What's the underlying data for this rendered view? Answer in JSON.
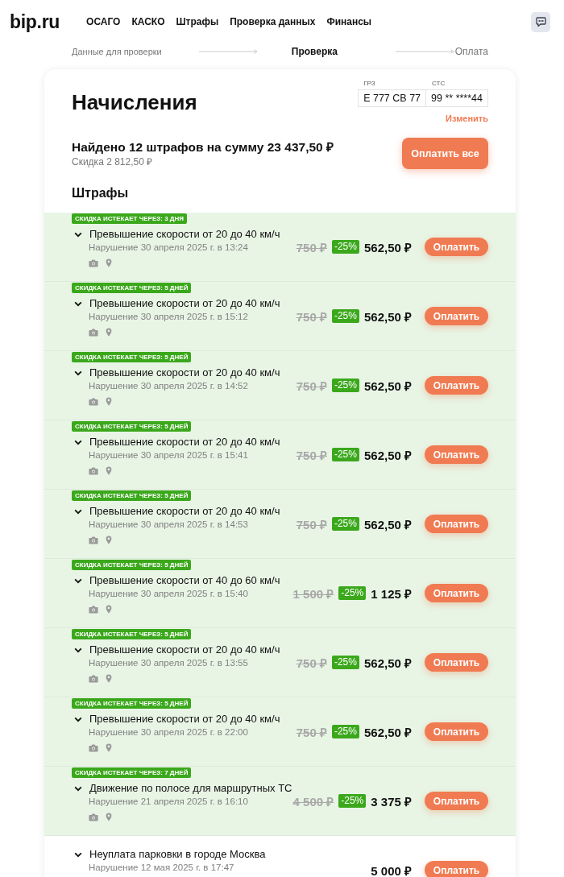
{
  "header": {
    "logo": "bip.ru",
    "nav": [
      {
        "label": "ОСАГО"
      },
      {
        "label": "КАСКО"
      },
      {
        "label": "Штрафы"
      },
      {
        "label": "Проверка данных"
      },
      {
        "label": "Финансы"
      }
    ]
  },
  "stepper": [
    {
      "label": "Данные для проверки",
      "selected": false
    },
    {
      "label": "Проверка",
      "selected": true
    },
    {
      "label": "Оплата",
      "selected": false
    }
  ],
  "charges": {
    "title": "Начисления",
    "documents": [
      {
        "label": "ГРЗ",
        "value": "Е 777 СВ 77"
      },
      {
        "label": "СТС",
        "value": "99 ** ****44"
      }
    ],
    "change_link": "Изменить",
    "summary": "Найдено 12 штрафов на сумму 23 437,50 ₽",
    "discount": "Скидка 2 812,50 ₽",
    "pay_all_button": "Оплатить все",
    "section_title": "Штрафы",
    "fines": [
      {
        "kind": "discounted",
        "badge": "СКИДКА ИСТЕКАЕТ ЧЕРЕЗ: 3 ДНЯ",
        "title": "Превышение скорости от 20 до 40 км/ч",
        "date": "Нарушение 30 апреля 2025 г. в 13:24",
        "old_price": "750 ₽",
        "discount": "-25%",
        "price": "562,50 ₽",
        "button": "Оплатить"
      },
      {
        "kind": "discounted",
        "badge": "СКИДКА ИСТЕКАЕТ ЧЕРЕЗ: 5 ДНЕЙ",
        "title": "Превышение скорости от 20 до 40 км/ч",
        "date": "Нарушение 30 апреля 2025 г. в 15:12",
        "old_price": "750 ₽",
        "discount": "-25%",
        "price": "562,50 ₽",
        "button": "Оплатить"
      },
      {
        "kind": "discounted",
        "badge": "СКИДКА ИСТЕКАЕТ ЧЕРЕЗ: 5 ДНЕЙ",
        "title": "Превышение скорости от 20 до 40 км/ч",
        "date": "Нарушение 30 апреля 2025 г. в 14:52",
        "old_price": "750 ₽",
        "discount": "-25%",
        "price": "562,50 ₽",
        "button": "Оплатить"
      },
      {
        "kind": "discounted",
        "badge": "СКИДКА ИСТЕКАЕТ ЧЕРЕЗ: 5 ДНЕЙ",
        "title": "Превышение скорости от 20 до 40 км/ч",
        "date": "Нарушение 30 апреля 2025 г. в 15:41",
        "old_price": "750 ₽",
        "discount": "-25%",
        "price": "562,50 ₽",
        "button": "Оплатить"
      },
      {
        "kind": "discounted",
        "badge": "СКИДКА ИСТЕКАЕТ ЧЕРЕЗ: 5 ДНЕЙ",
        "title": "Превышение скорости от 20 до 40 км/ч",
        "date": "Нарушение 30 апреля 2025 г. в 14:53",
        "old_price": "750 ₽",
        "discount": "-25%",
        "price": "562,50 ₽",
        "button": "Оплатить"
      },
      {
        "kind": "discounted",
        "badge": "СКИДКА ИСТЕКАЕТ ЧЕРЕЗ: 5 ДНЕЙ",
        "title": "Превышение скорости от 40 до 60 км/ч",
        "date": "Нарушение 30 апреля 2025 г. в 15:40",
        "old_price": "1 500 ₽",
        "discount": "-25%",
        "price": "1 125 ₽",
        "button": "Оплатить"
      },
      {
        "kind": "discounted",
        "badge": "СКИДКА ИСТЕКАЕТ ЧЕРЕЗ: 5 ДНЕЙ",
        "title": "Превышение скорости от 20 до 40 км/ч",
        "date": "Нарушение 30 апреля 2025 г. в 13:55",
        "old_price": "750 ₽",
        "discount": "-25%",
        "price": "562,50 ₽",
        "button": "Оплатить"
      },
      {
        "kind": "discounted",
        "badge": "СКИДКА ИСТЕКАЕТ ЧЕРЕЗ: 5 ДНЕЙ",
        "title": "Превышение скорости от 20 до 40 км/ч",
        "date": "Нарушение 30 апреля 2025 г. в 22:00",
        "old_price": "750 ₽",
        "discount": "-25%",
        "price": "562,50 ₽",
        "button": "Оплатить"
      },
      {
        "kind": "discounted",
        "badge": "СКИДКА ИСТЕКАЕТ ЧЕРЕЗ: 7 ДНЕЙ",
        "title": "Движение по полосе для маршрутных ТС",
        "date": "Нарушение 21 апреля 2025 г. в 16:10",
        "old_price": "4 500 ₽",
        "discount": "-25%",
        "price": "3 375 ₽",
        "button": "Оплатить"
      },
      {
        "kind": "regular",
        "title": "Неуплата парковки в городе Москва",
        "date": "Нарушение 12 мая 2025 г. в 17:47",
        "price": "5 000 ₽",
        "button": "Оплатить"
      }
    ]
  }
}
